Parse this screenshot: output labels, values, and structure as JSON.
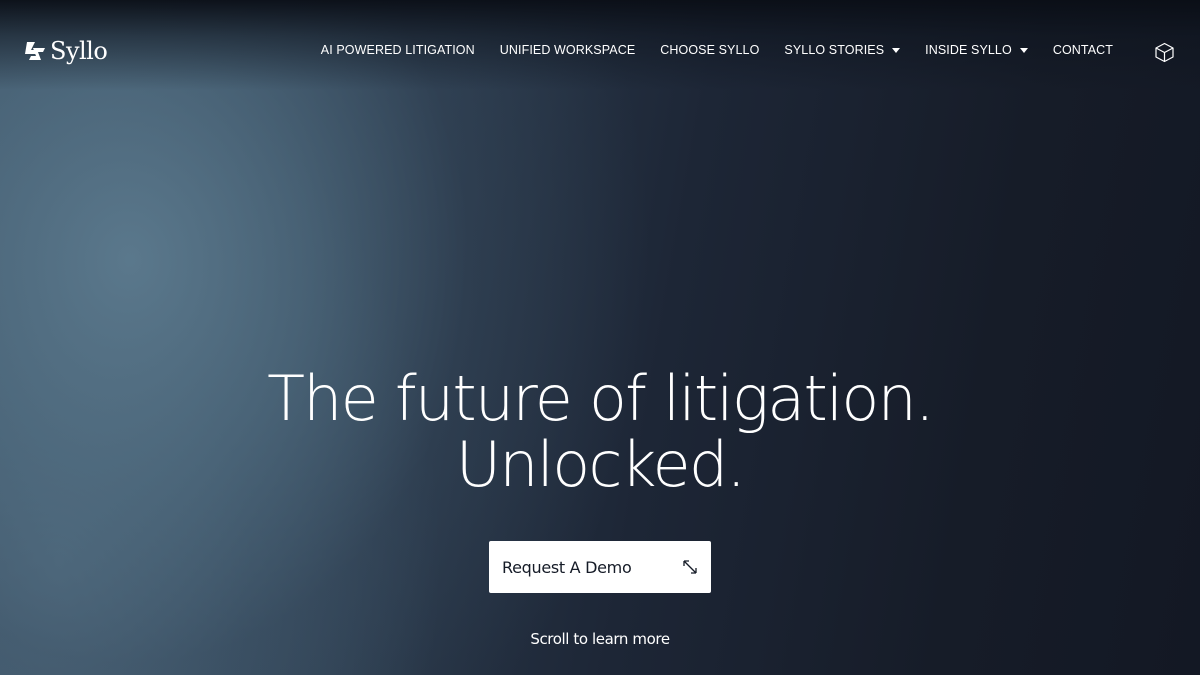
{
  "brand": {
    "name": "Syllo",
    "logo_icon": "syllo-bolt-mark-icon"
  },
  "nav": {
    "items": [
      {
        "label": "AI POWERED LITIGATION",
        "dropdown": false
      },
      {
        "label": "UNIFIED WORKSPACE",
        "dropdown": false
      },
      {
        "label": "CHOOSE SYLLO",
        "dropdown": false
      },
      {
        "label": "SYLLO STORIES",
        "dropdown": true
      },
      {
        "label": "INSIDE SYLLO",
        "dropdown": true
      },
      {
        "label": "CONTACT",
        "dropdown": false
      }
    ],
    "cube_icon": "cube-icon"
  },
  "hero": {
    "title_line1": "The future of litigation.",
    "title_line2": "Unlocked.",
    "cta_label": "Request A Demo",
    "cta_icon": "diagonal-arrows-icon",
    "scroll_hint": "Scroll to learn more"
  },
  "colors": {
    "background_dark": "#141a26",
    "background_light": "#5c7a8e",
    "text": "#ffffff",
    "button_bg": "#ffffff",
    "button_text": "#151b27"
  }
}
